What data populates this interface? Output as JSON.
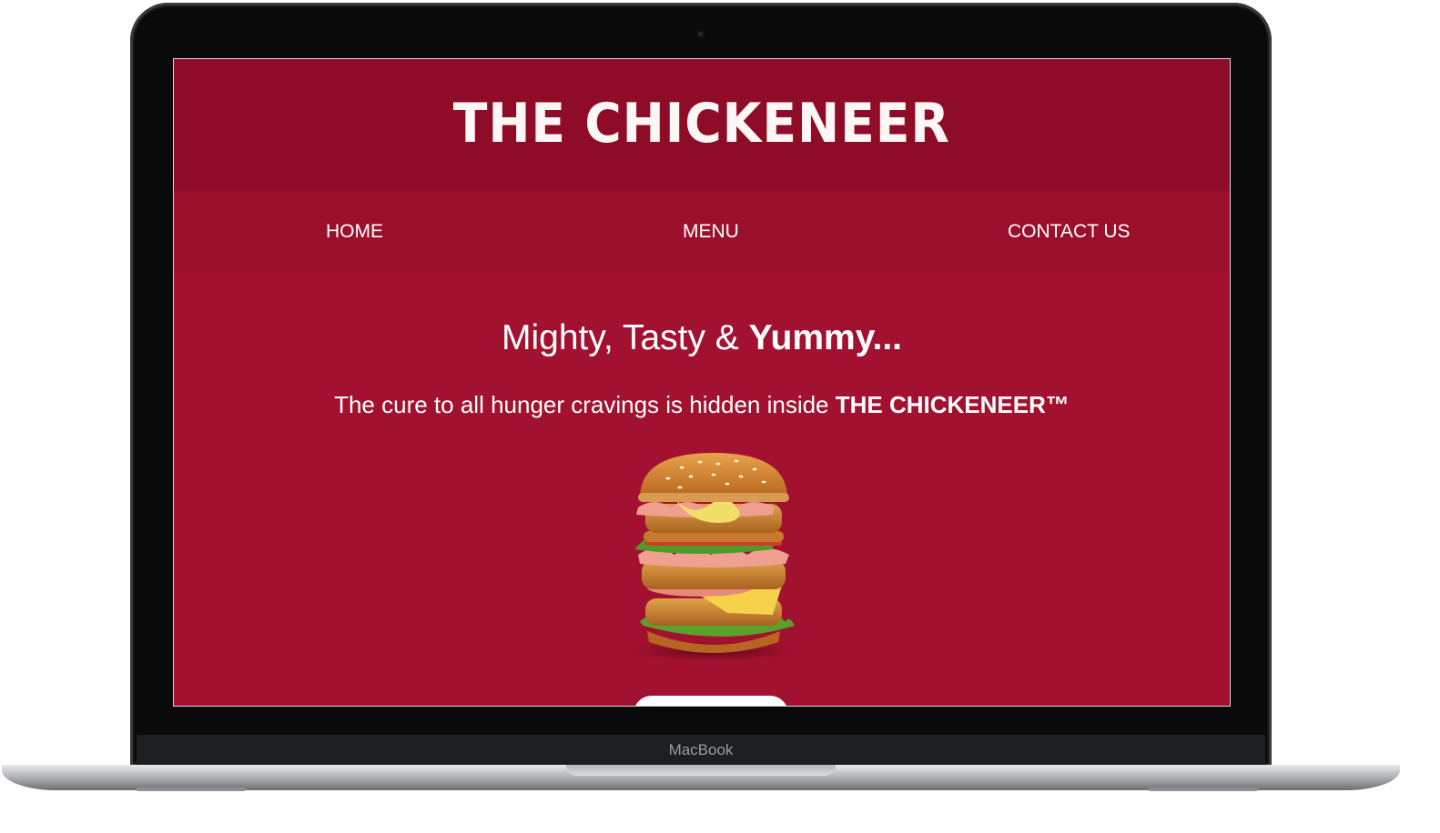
{
  "device": {
    "brand_label": "MacBook"
  },
  "site": {
    "logo": "THE CHICKENEER",
    "nav": {
      "items": [
        "HOME",
        "MENU",
        "CONTACT US"
      ]
    },
    "hero": {
      "title_light": "Mighty, Tasty & ",
      "title_bold": "Yummy...",
      "subtitle_light": "The cure to all hunger cravings is hidden inside ",
      "subtitle_bold": "THE CHICKENEER™"
    },
    "colors": {
      "header_bg": "#8e0c27",
      "nav_bg": "#9b0f2c",
      "page_bg": "#a31130",
      "text": "#ffffff"
    },
    "image": "burger-image",
    "cta_label": ""
  }
}
